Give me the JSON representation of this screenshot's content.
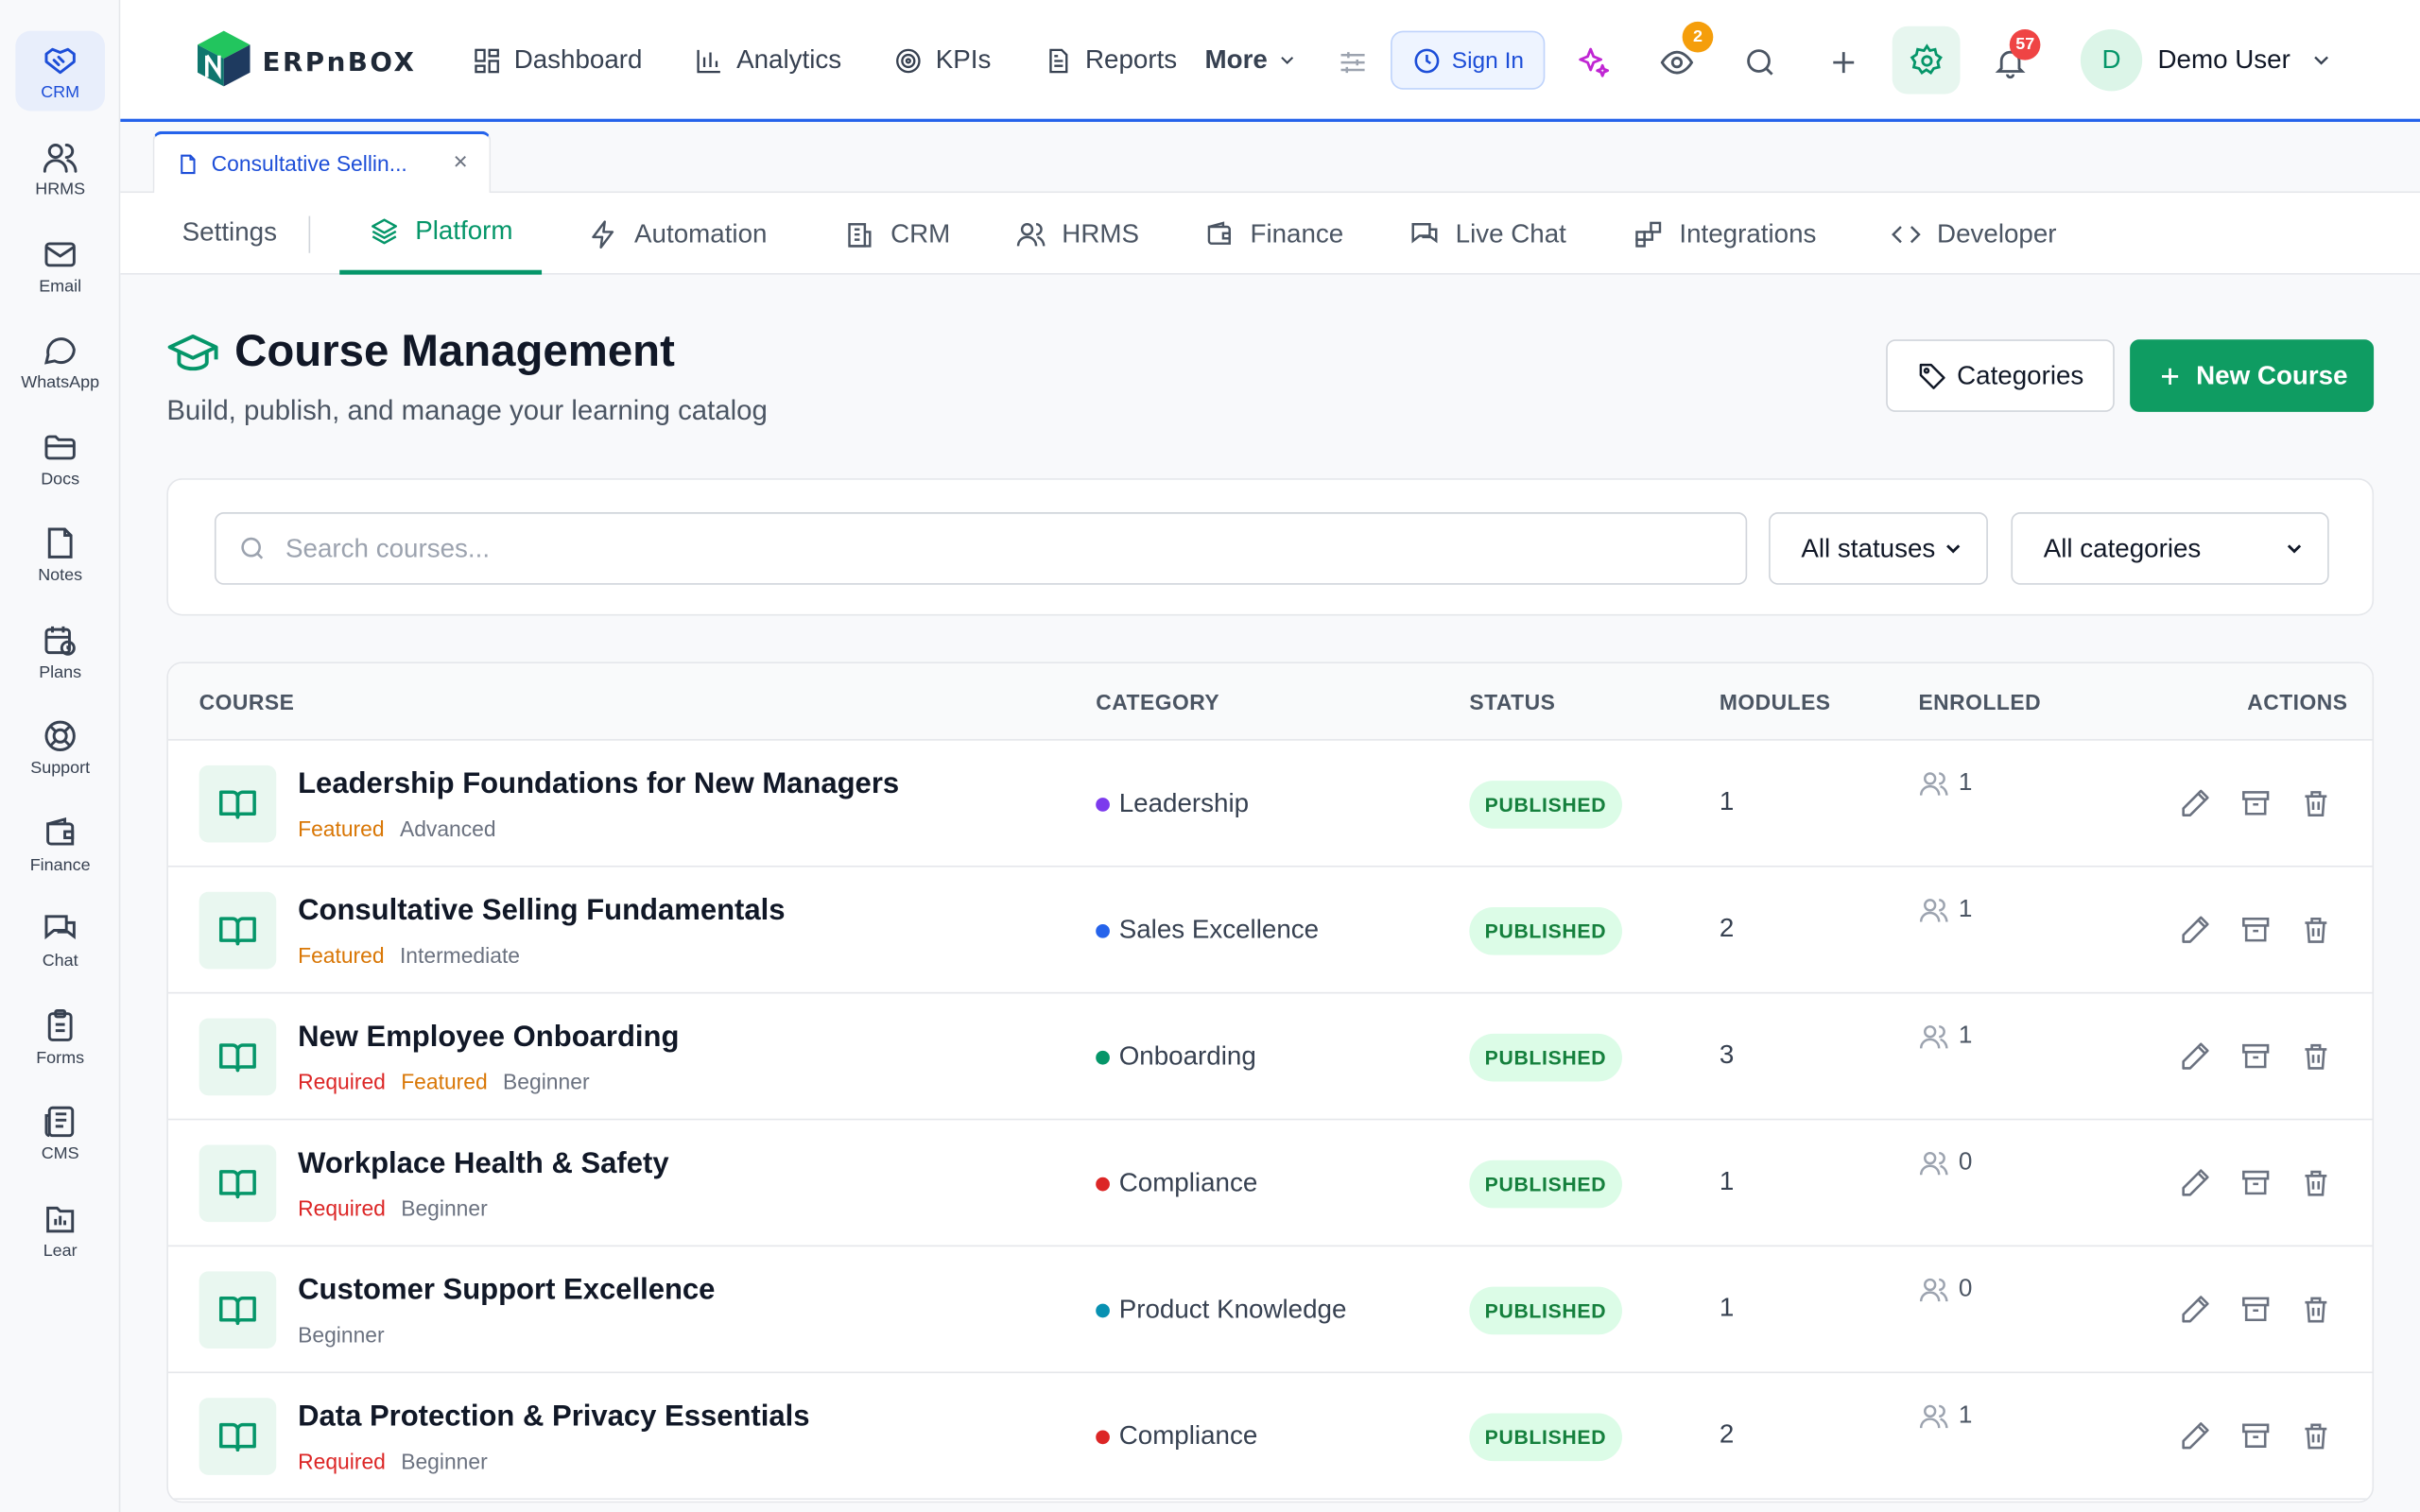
{
  "rail": [
    {
      "label": "CRM",
      "icon": "handshake-icon",
      "active": true
    },
    {
      "label": "HRMS",
      "icon": "users-icon"
    },
    {
      "label": "Email",
      "icon": "mail-icon"
    },
    {
      "label": "WhatsApp",
      "icon": "chat-bubble-icon"
    },
    {
      "label": "Docs",
      "icon": "folder-icon"
    },
    {
      "label": "Notes",
      "icon": "note-icon"
    },
    {
      "label": "Plans",
      "icon": "calendar-clock-icon"
    },
    {
      "label": "Support",
      "icon": "lifebuoy-icon"
    },
    {
      "label": "Finance",
      "icon": "wallet-icon"
    },
    {
      "label": "Chat",
      "icon": "chat-icon"
    },
    {
      "label": "Forms",
      "icon": "clipboard-icon"
    },
    {
      "label": "CMS",
      "icon": "newspaper-icon"
    },
    {
      "label": "Lear",
      "icon": "learning-icon"
    }
  ],
  "topbar": {
    "logo_text": "ERPnBOX",
    "nav": [
      {
        "label": "Dashboard",
        "icon": "grid-icon"
      },
      {
        "label": "Analytics",
        "icon": "bar-chart-icon"
      },
      {
        "label": "KPIs",
        "icon": "target-icon"
      },
      {
        "label": "Reports",
        "icon": "document-icon"
      }
    ],
    "more_label": "More",
    "signin_label": "Sign In",
    "watch_count": "2",
    "notification_count": "57",
    "user_initial": "D",
    "user_name": "Demo User"
  },
  "doc_tab": {
    "label": "Consultative Sellin...",
    "close": "×"
  },
  "settings_tabs": {
    "settings_label": "Settings",
    "tabs": [
      {
        "label": "Platform",
        "active": true
      },
      {
        "label": "Automation"
      },
      {
        "label": "CRM"
      },
      {
        "label": "HRMS"
      },
      {
        "label": "Finance"
      },
      {
        "label": "Live Chat"
      },
      {
        "label": "Integrations"
      },
      {
        "label": "Developer"
      }
    ]
  },
  "page": {
    "title": "Course Management",
    "subtitle": "Build, publish, and manage your learning catalog",
    "categories_button": "Categories",
    "new_course_button": "New Course"
  },
  "filters": {
    "search_placeholder": "Search courses...",
    "status_value": "All statuses",
    "category_value": "All categories"
  },
  "table": {
    "headers": {
      "course": "COURSE",
      "category": "CATEGORY",
      "status": "STATUS",
      "modules": "MODULES",
      "enrolled": "ENROLLED",
      "actions": "ACTIONS"
    },
    "rows": [
      {
        "title": "Leadership Foundations for New Managers",
        "tags": [
          {
            "text": "Featured",
            "kind": "featured"
          },
          {
            "text": "Advanced",
            "kind": "level"
          }
        ],
        "category": "Leadership",
        "category_color": "#7c3aed",
        "status": "PUBLISHED",
        "modules": "1",
        "enrolled": "1"
      },
      {
        "title": "Consultative Selling Fundamentals",
        "tags": [
          {
            "text": "Featured",
            "kind": "featured"
          },
          {
            "text": "Intermediate",
            "kind": "level"
          }
        ],
        "category": "Sales Excellence",
        "category_color": "#2563eb",
        "status": "PUBLISHED",
        "modules": "2",
        "enrolled": "1"
      },
      {
        "title": "New Employee Onboarding",
        "tags": [
          {
            "text": "Required",
            "kind": "required"
          },
          {
            "text": "Featured",
            "kind": "featured"
          },
          {
            "text": "Beginner",
            "kind": "level"
          }
        ],
        "category": "Onboarding",
        "category_color": "#059669",
        "status": "PUBLISHED",
        "modules": "3",
        "enrolled": "1"
      },
      {
        "title": "Workplace Health & Safety",
        "tags": [
          {
            "text": "Required",
            "kind": "required"
          },
          {
            "text": "Beginner",
            "kind": "level"
          }
        ],
        "category": "Compliance",
        "category_color": "#dc2626",
        "status": "PUBLISHED",
        "modules": "1",
        "enrolled": "0"
      },
      {
        "title": "Customer Support Excellence",
        "tags": [
          {
            "text": "Beginner",
            "kind": "level"
          }
        ],
        "category": "Product Knowledge",
        "category_color": "#0891b2",
        "status": "PUBLISHED",
        "modules": "1",
        "enrolled": "0"
      },
      {
        "title": "Data Protection & Privacy Essentials",
        "tags": [
          {
            "text": "Required",
            "kind": "required"
          },
          {
            "text": "Beginner",
            "kind": "level"
          }
        ],
        "category": "Compliance",
        "category_color": "#dc2626",
        "status": "PUBLISHED",
        "modules": "2",
        "enrolled": "1"
      }
    ]
  }
}
